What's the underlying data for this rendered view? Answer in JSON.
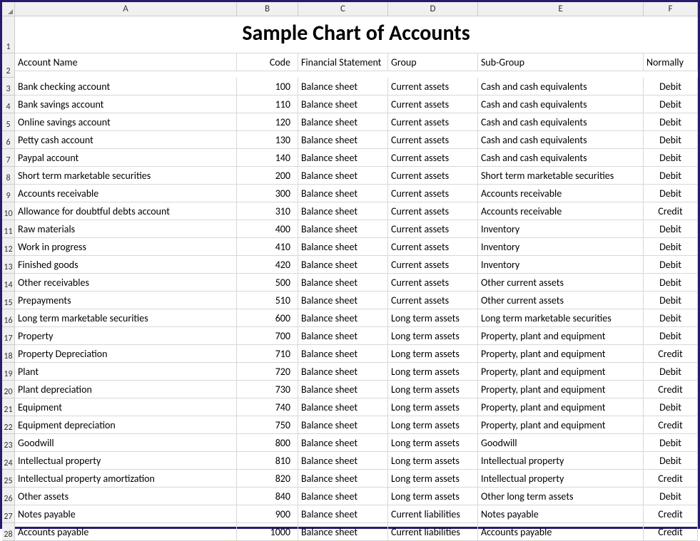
{
  "columns": [
    "A",
    "B",
    "C",
    "D",
    "E",
    "F"
  ],
  "title": "Sample Chart of Accounts",
  "headers": {
    "a": "Account Name",
    "b": "Code",
    "c": "Financial Statement",
    "d": "Group",
    "e": "Sub-Group",
    "f": "Normally"
  },
  "rows": [
    {
      "n": 3,
      "a": "Bank checking account",
      "b": "100",
      "c": "Balance sheet",
      "d": "Current assets",
      "e": "Cash and cash equivalents",
      "f": "Debit"
    },
    {
      "n": 4,
      "a": "Bank savings account",
      "b": "110",
      "c": "Balance sheet",
      "d": "Current assets",
      "e": "Cash and cash equivalents",
      "f": "Debit"
    },
    {
      "n": 5,
      "a": "Online savings account",
      "b": "120",
      "c": "Balance sheet",
      "d": "Current assets",
      "e": "Cash and cash equivalents",
      "f": "Debit"
    },
    {
      "n": 6,
      "a": "Petty cash account",
      "b": "130",
      "c": "Balance sheet",
      "d": "Current assets",
      "e": "Cash and cash equivalents",
      "f": "Debit"
    },
    {
      "n": 7,
      "a": "Paypal account",
      "b": "140",
      "c": "Balance sheet",
      "d": "Current assets",
      "e": "Cash and cash equivalents",
      "f": "Debit"
    },
    {
      "n": 8,
      "a": "Short term marketable securities",
      "b": "200",
      "c": "Balance sheet",
      "d": "Current assets",
      "e": "Short term marketable securities",
      "f": "Debit"
    },
    {
      "n": 9,
      "a": "Accounts receivable",
      "b": "300",
      "c": "Balance sheet",
      "d": "Current assets",
      "e": "Accounts receivable",
      "f": "Debit"
    },
    {
      "n": 10,
      "a": "Allowance for doubtful debts account",
      "b": "310",
      "c": "Balance sheet",
      "d": "Current assets",
      "e": "Accounts receivable",
      "f": "Credit"
    },
    {
      "n": 11,
      "a": "Raw materials",
      "b": "400",
      "c": "Balance sheet",
      "d": "Current assets",
      "e": "Inventory",
      "f": "Debit"
    },
    {
      "n": 12,
      "a": "Work in progress",
      "b": "410",
      "c": "Balance sheet",
      "d": "Current assets",
      "e": "Inventory",
      "f": "Debit"
    },
    {
      "n": 13,
      "a": "Finished goods",
      "b": "420",
      "c": "Balance sheet",
      "d": "Current assets",
      "e": "Inventory",
      "f": "Debit"
    },
    {
      "n": 14,
      "a": "Other receivables",
      "b": "500",
      "c": "Balance sheet",
      "d": "Current assets",
      "e": "Other current assets",
      "f": "Debit"
    },
    {
      "n": 15,
      "a": "Prepayments",
      "b": "510",
      "c": "Balance sheet",
      "d": "Current assets",
      "e": "Other current assets",
      "f": "Debit"
    },
    {
      "n": 16,
      "a": "Long term marketable securities",
      "b": "600",
      "c": "Balance sheet",
      "d": "Long term assets",
      "e": "Long term marketable securities",
      "f": "Debit"
    },
    {
      "n": 17,
      "a": "Property",
      "b": "700",
      "c": "Balance sheet",
      "d": "Long term assets",
      "e": "Property, plant and equipment",
      "f": "Debit"
    },
    {
      "n": 18,
      "a": "Property Depreciation",
      "b": "710",
      "c": "Balance sheet",
      "d": "Long term assets",
      "e": "Property, plant and equipment",
      "f": "Credit"
    },
    {
      "n": 19,
      "a": "Plant",
      "b": "720",
      "c": "Balance sheet",
      "d": "Long term assets",
      "e": "Property, plant and equipment",
      "f": "Debit"
    },
    {
      "n": 20,
      "a": "Plant depreciation",
      "b": "730",
      "c": "Balance sheet",
      "d": "Long term assets",
      "e": "Property, plant and equipment",
      "f": "Credit"
    },
    {
      "n": 21,
      "a": "Equipment",
      "b": "740",
      "c": "Balance sheet",
      "d": "Long term assets",
      "e": "Property, plant and equipment",
      "f": "Debit"
    },
    {
      "n": 22,
      "a": "Equipment depreciation",
      "b": "750",
      "c": "Balance sheet",
      "d": "Long term assets",
      "e": "Property, plant and equipment",
      "f": "Credit"
    },
    {
      "n": 23,
      "a": "Goodwill",
      "b": "800",
      "c": "Balance sheet",
      "d": "Long term assets",
      "e": "Goodwill",
      "f": "Debit"
    },
    {
      "n": 24,
      "a": "Intellectual property",
      "b": "810",
      "c": "Balance sheet",
      "d": "Long term assets",
      "e": "Intellectual property",
      "f": "Debit"
    },
    {
      "n": 25,
      "a": "Intellectual property amortization",
      "b": "820",
      "c": "Balance sheet",
      "d": "Long term assets",
      "e": "Intellectual property",
      "f": "Credit"
    },
    {
      "n": 26,
      "a": "Other assets",
      "b": "840",
      "c": "Balance sheet",
      "d": "Long term assets",
      "e": "Other long term assets",
      "f": "Debit"
    },
    {
      "n": 27,
      "a": "Notes payable",
      "b": "900",
      "c": "Balance sheet",
      "d": "Current liabilities",
      "e": "Notes payable",
      "f": "Credit"
    },
    {
      "n": 28,
      "a": "Accounts payable",
      "b": "1000",
      "c": "Balance sheet",
      "d": "Current liabilities",
      "e": "Accounts payable",
      "f": "Credit"
    }
  ]
}
